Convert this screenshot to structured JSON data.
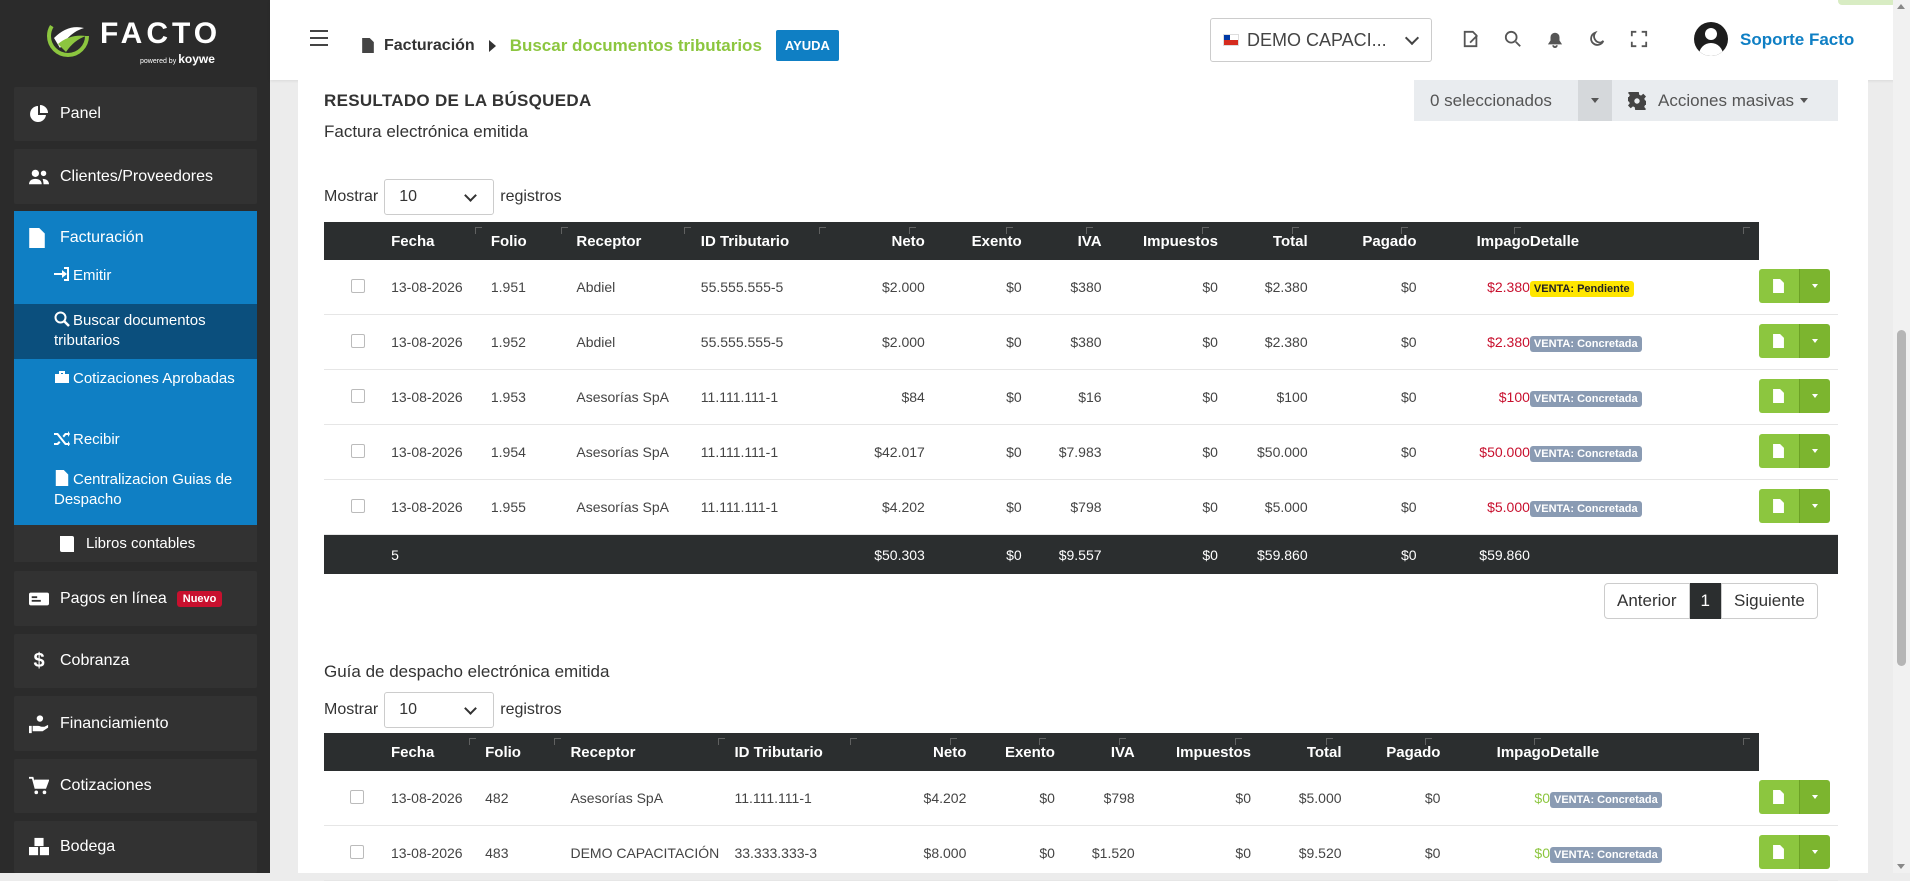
{
  "brand": {
    "logo_text": "FACTO",
    "powered_prefix": "powered by",
    "powered_name": "koywe"
  },
  "sidebar": {
    "panel": "Panel",
    "clientes": "Clientes/Proveedores",
    "facturacion": "Facturación",
    "sub": {
      "emitir": "Emitir",
      "buscar": "Buscar documentos tributarios",
      "cotizaciones_aprobadas": "Cotizaciones Aprobadas",
      "recibir": "Recibir",
      "centralizacion": "Centralizacion Guias de Despacho"
    },
    "libros": "Libros contables",
    "pagos": "Pagos en línea",
    "pagos_badge": "Nuevo",
    "cobranza": "Cobranza",
    "financiamiento": "Financiamiento",
    "cotizaciones": "Cotizaciones",
    "bodega": "Bodega"
  },
  "topbar": {
    "crumb1": "Facturación",
    "crumb2": "Buscar documentos tributarios",
    "help": "AYUDA",
    "company": "DEMO CAPACI...",
    "user": "Soporte Facto"
  },
  "results": {
    "title": "RESULTADO DE LA BÚSQUEDA",
    "selected": "0 seleccionados",
    "bulk": "Acciones masivas"
  },
  "common": {
    "show": "Mostrar",
    "records": "registros",
    "length": "10",
    "prev": "Anterior",
    "page": "1",
    "next": "Siguiente"
  },
  "facturas": {
    "title": "Factura electrónica emitida",
    "headers": [
      "Fecha",
      "Folio",
      "Receptor",
      "ID Tributario",
      "Neto",
      "Exento",
      "IVA",
      "Impuestos",
      "Total",
      "Pagado",
      "Impago",
      "Detalle"
    ],
    "rows": [
      {
        "fecha": "13-08-2026",
        "folio": "1.951",
        "receptor": "Abdiel",
        "id": "55.555.555-5",
        "neto": "$2.000",
        "exento": "$0",
        "iva": "$380",
        "imp": "$0",
        "total": "$2.380",
        "pagado": "$0",
        "impago": "$2.380",
        "detalle": "VENTA: Pendiente"
      },
      {
        "fecha": "13-08-2026",
        "folio": "1.952",
        "receptor": "Abdiel",
        "id": "55.555.555-5",
        "neto": "$2.000",
        "exento": "$0",
        "iva": "$380",
        "imp": "$0",
        "total": "$2.380",
        "pagado": "$0",
        "impago": "$2.380",
        "detalle": "VENTA: Concretada"
      },
      {
        "fecha": "13-08-2026",
        "folio": "1.953",
        "receptor": "Asesorías SpA",
        "id": "11.111.111-1",
        "neto": "$84",
        "exento": "$0",
        "iva": "$16",
        "imp": "$0",
        "total": "$100",
        "pagado": "$0",
        "impago": "$100",
        "detalle": "VENTA: Concretada"
      },
      {
        "fecha": "13-08-2026",
        "folio": "1.954",
        "receptor": "Asesorías SpA",
        "id": "11.111.111-1",
        "neto": "$42.017",
        "exento": "$0",
        "iva": "$7.983",
        "imp": "$0",
        "total": "$50.000",
        "pagado": "$0",
        "impago": "$50.000",
        "detalle": "VENTA: Concretada"
      },
      {
        "fecha": "13-08-2026",
        "folio": "1.955",
        "receptor": "Asesorías SpA",
        "id": "11.111.111-1",
        "neto": "$4.202",
        "exento": "$0",
        "iva": "$798",
        "imp": "$0",
        "total": "$5.000",
        "pagado": "$0",
        "impago": "$5.000",
        "detalle": "VENTA: Concretada"
      }
    ],
    "footer": {
      "count": "5",
      "neto": "$50.303",
      "exento": "$0",
      "iva": "$9.557",
      "imp": "$0",
      "total": "$59.860",
      "pagado": "$0",
      "impago": "$59.860"
    }
  },
  "guias": {
    "title": "Guía de despacho electrónica emitida",
    "headers": [
      "Fecha",
      "Folio",
      "Receptor",
      "ID Tributario",
      "Neto",
      "Exento",
      "IVA",
      "Impuestos",
      "Total",
      "Pagado",
      "Impago",
      "Detalle"
    ],
    "rows": [
      {
        "fecha": "13-08-2026",
        "folio": "482",
        "receptor": "Asesorías SpA",
        "id": "11.111.111-1",
        "neto": "$4.202",
        "exento": "$0",
        "iva": "$798",
        "imp": "$0",
        "total": "$5.000",
        "pagado": "$0",
        "impago": "$0",
        "detalle": "VENTA: Concretada"
      },
      {
        "fecha": "13-08-2026",
        "folio": "483",
        "receptor": "DEMO CAPACITACIÓN",
        "id": "33.333.333-3",
        "neto": "$8.000",
        "exento": "$0",
        "iva": "$1.520",
        "imp": "$0",
        "total": "$9.520",
        "pagado": "$0",
        "impago": "$0",
        "detalle": "VENTA: Concretada"
      }
    ]
  },
  "colors": {
    "brand_green": "#8cc63f",
    "sidebar_blue": "#0f7fc4",
    "sidebar_dark": "#2b2b2b",
    "danger": "#c8102e"
  }
}
